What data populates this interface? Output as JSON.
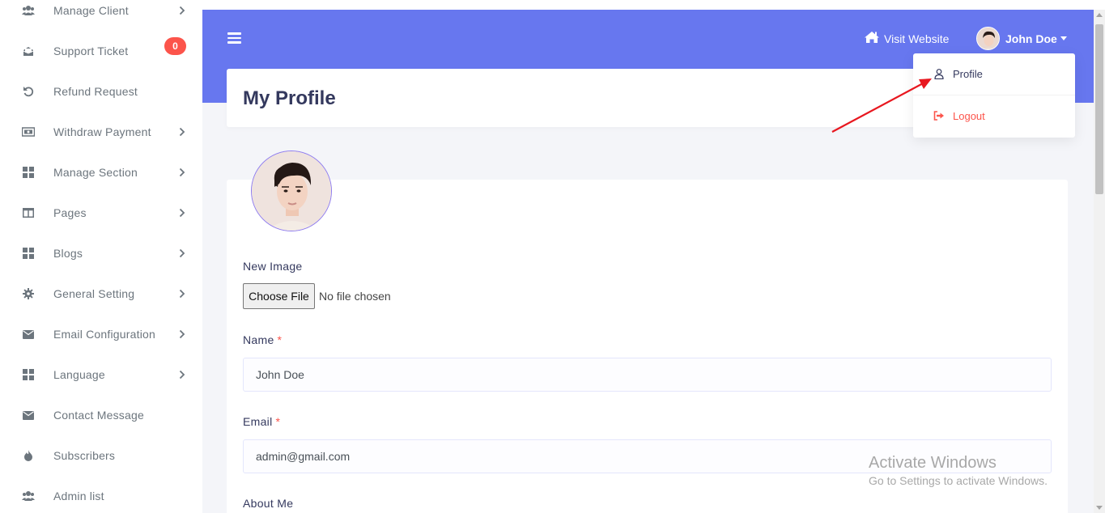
{
  "sidebar": {
    "items": [
      {
        "label": "Manage Client",
        "icon": "users-icon",
        "chevron": true
      },
      {
        "label": "Support Ticket",
        "icon": "envelope-open-icon",
        "chevron": false,
        "badge": "0"
      },
      {
        "label": "Refund Request",
        "icon": "undo-icon",
        "chevron": false
      },
      {
        "label": "Withdraw Payment",
        "icon": "money-bill-icon",
        "chevron": true
      },
      {
        "label": "Manage Section",
        "icon": "th-large-icon",
        "chevron": true
      },
      {
        "label": "Pages",
        "icon": "columns-icon",
        "chevron": true
      },
      {
        "label": "Blogs",
        "icon": "th-large-icon",
        "chevron": true
      },
      {
        "label": "General Setting",
        "icon": "cog-icon",
        "chevron": true
      },
      {
        "label": "Email Configuration",
        "icon": "envelope-icon",
        "chevron": true
      },
      {
        "label": "Language",
        "icon": "th-large-icon",
        "chevron": true
      },
      {
        "label": "Contact Message",
        "icon": "envelope-icon",
        "chevron": false
      },
      {
        "label": "Subscribers",
        "icon": "fire-icon",
        "chevron": false
      },
      {
        "label": "Admin list",
        "icon": "users-icon",
        "chevron": false
      }
    ]
  },
  "header": {
    "visit_label": "Visit Website",
    "user_name": "John Doe"
  },
  "dropdown": {
    "profile_label": "Profile",
    "logout_label": "Logout"
  },
  "page": {
    "title": "My Profile"
  },
  "form": {
    "new_image_label": "New Image",
    "choose_file_label": "Choose File",
    "file_status": "No file chosen",
    "name_label": "Name",
    "name_value": "John Doe",
    "email_label": "Email",
    "email_value": "admin@gmail.com",
    "about_label": "About Me",
    "required_mark": "*"
  },
  "watermark": {
    "line1": "Activate Windows",
    "line2": "Go to Settings to activate Windows."
  },
  "colors": {
    "primary": "#6777ef",
    "danger": "#fc544b",
    "sidebar_text": "#6c757d",
    "heading": "#34395e"
  }
}
